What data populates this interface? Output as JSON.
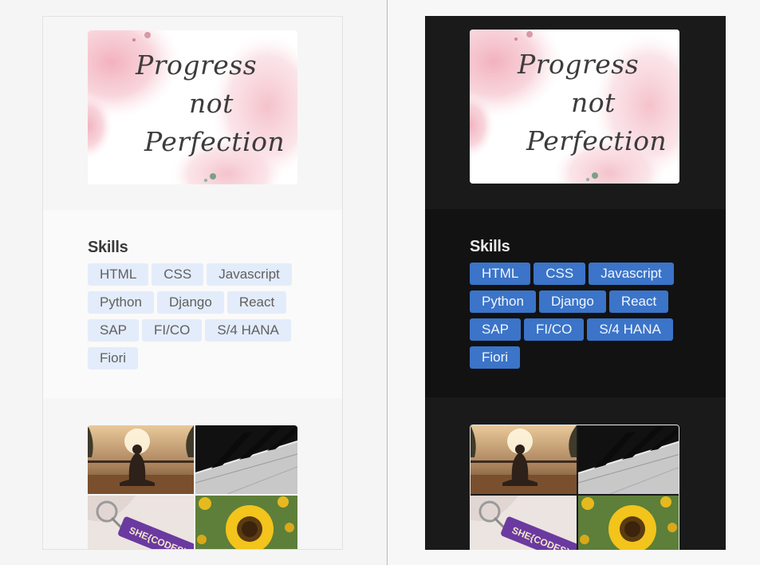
{
  "quote": {
    "line1": "Progress",
    "line2": "not",
    "line3": "Perfection"
  },
  "skills": {
    "title": "Skills",
    "tags": [
      "HTML",
      "CSS",
      "Javascript",
      "Python",
      "Django",
      "React",
      "SAP",
      "FI/CO",
      "S/4 HANA",
      "Fiori"
    ]
  },
  "gallery": {
    "photos": [
      "meditation-photo",
      "piano-keys-photo",
      "she-codes-keychain-photo",
      "sunflower-photo"
    ],
    "keychain_text": "SHE{CODES}"
  },
  "colors": {
    "light_tag_bg": "#e3ecfa",
    "dark_tag_bg": "#3b74c8",
    "dark_card_bg": "#181818"
  }
}
